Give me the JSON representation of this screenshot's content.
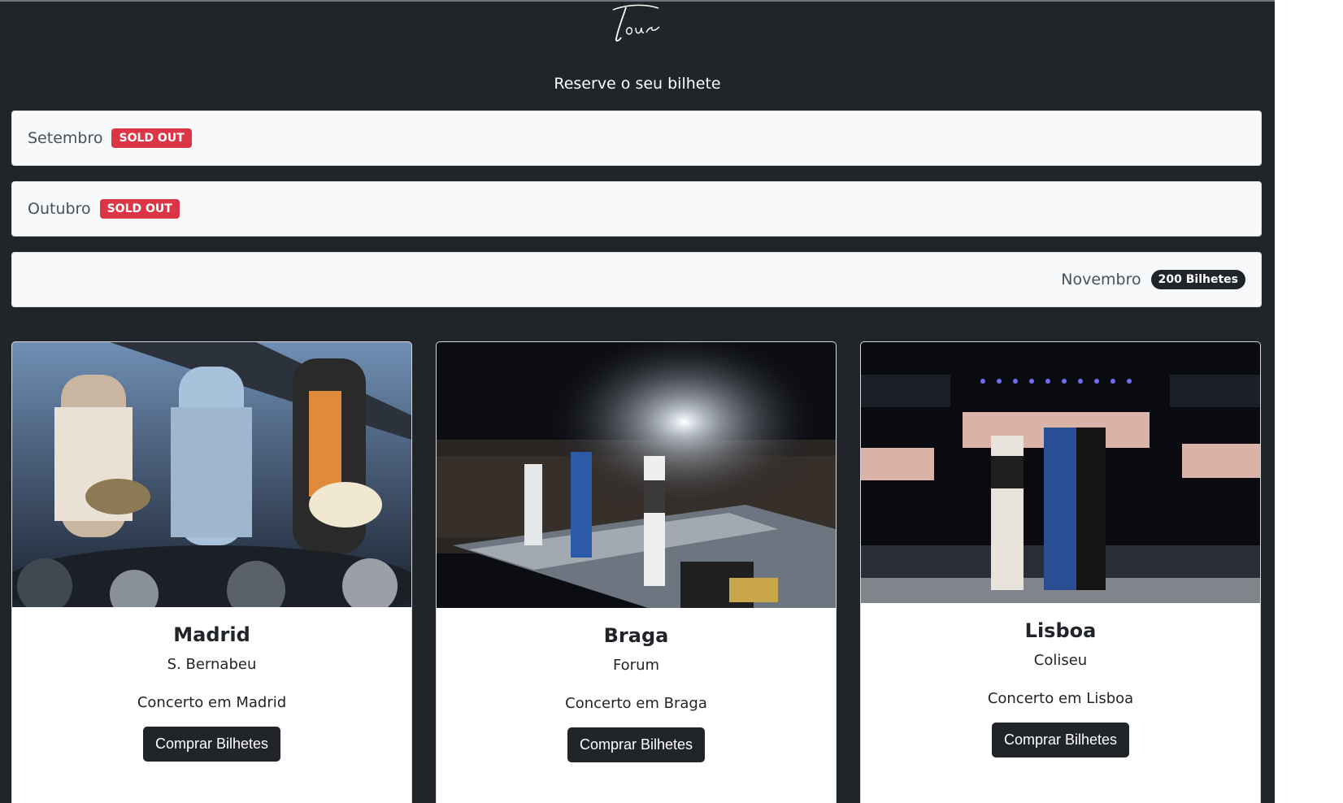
{
  "header": {
    "logo_text": "Tour",
    "subtitle": "Reserve o seu bilhete"
  },
  "months": [
    {
      "label": "Setembro",
      "badge": "SOLD OUT",
      "badge_color": "#dc3545"
    },
    {
      "label": "Outubro",
      "badge": "SOLD OUT",
      "badge_color": "#dc3545"
    },
    {
      "label": "Novembro",
      "badge": "200 Bilhetes",
      "badge_color": "#212529"
    }
  ],
  "concerts": [
    {
      "city": "Madrid",
      "venue": "S. Bernabeu",
      "description": "Concerto em Madrid",
      "button": "Comprar Bilhetes",
      "image": "band-performing-outdoor-stage-photo"
    },
    {
      "city": "Braga",
      "venue": "Forum",
      "description": "Concerto em Braga",
      "button": "Comprar Bilhetes",
      "image": "band-on-stage-stadium-crowd-photo"
    },
    {
      "city": "Lisboa",
      "venue": "Coliseu",
      "description": "Concerto em Lisboa",
      "button": "Comprar Bilhetes",
      "image": "band-on-stage-arena-screens-photo"
    }
  ]
}
